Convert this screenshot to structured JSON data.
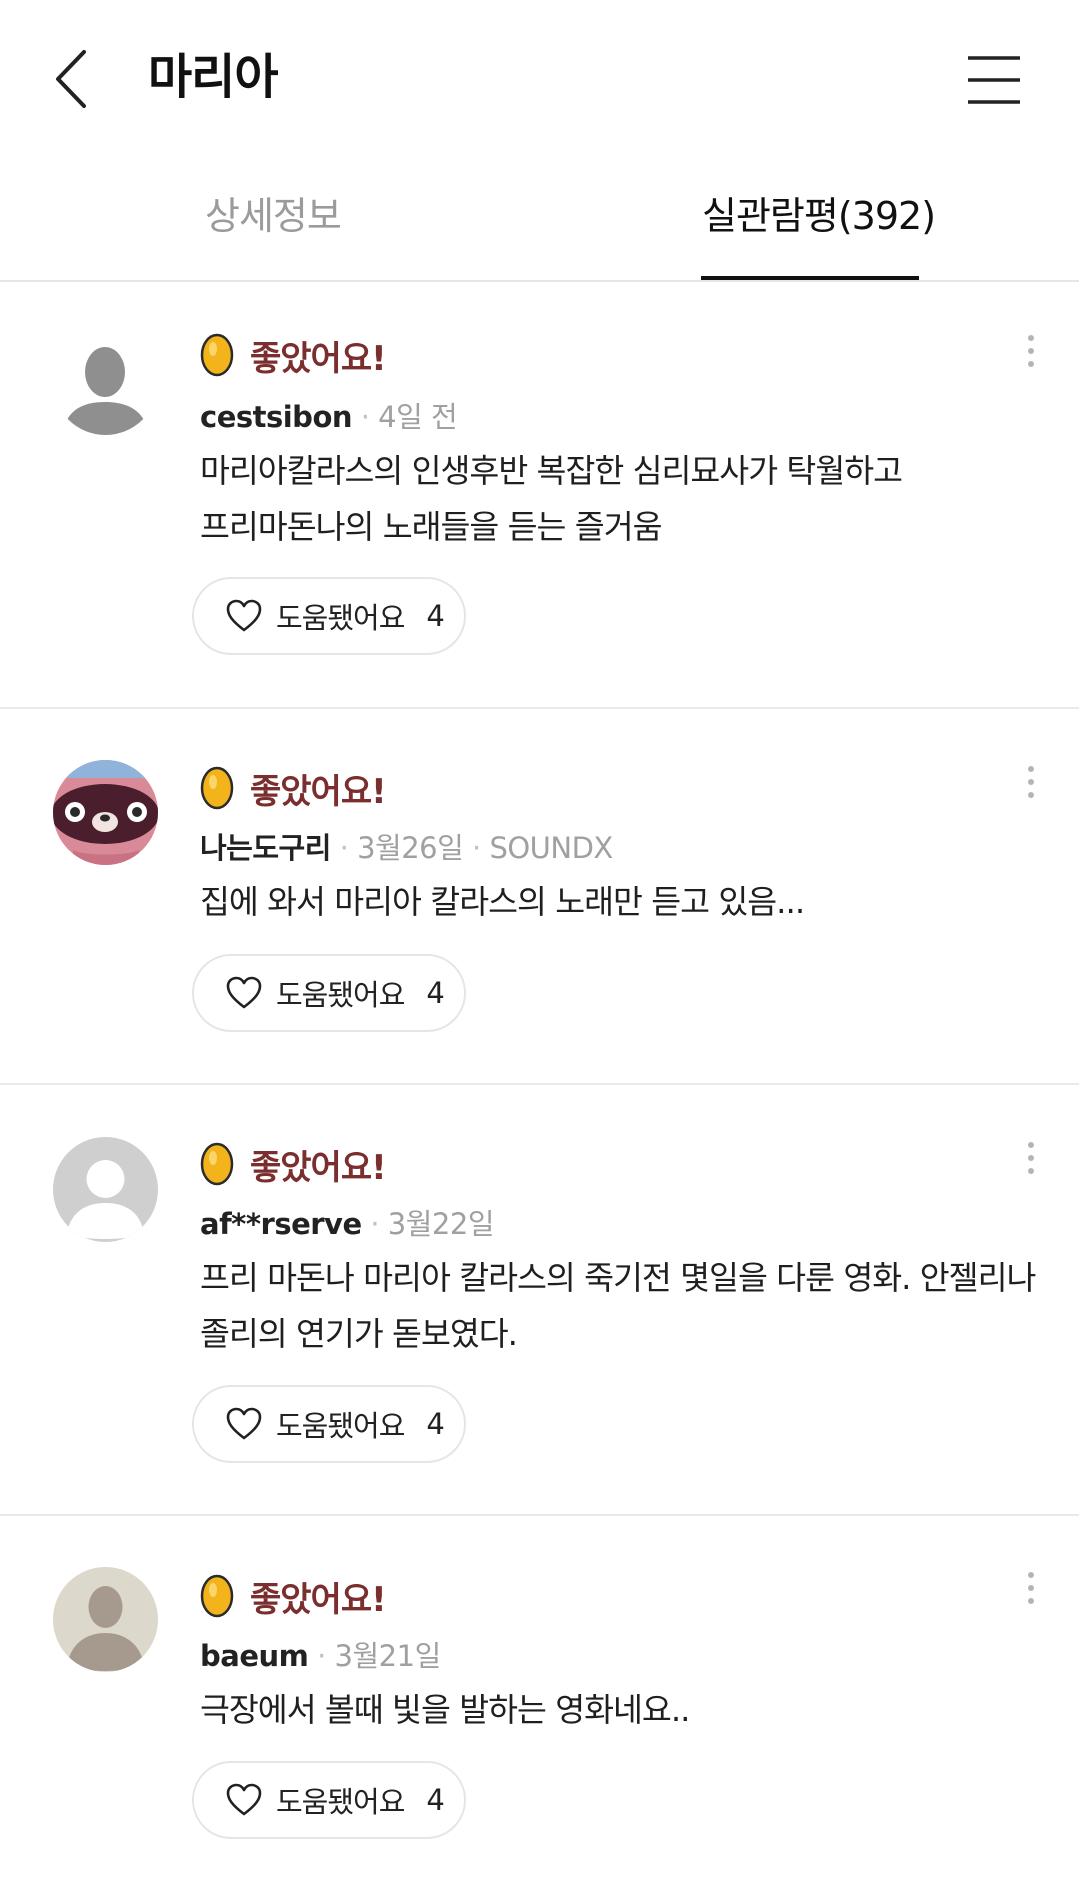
{
  "header": {
    "title": "마리아",
    "back_icon": "chevron-left-icon",
    "menu_icon": "hamburger-menu-icon"
  },
  "tabs": [
    {
      "label": "상세정보",
      "active": false
    },
    {
      "label": "실관람평(392)",
      "active": true
    }
  ],
  "colors": {
    "rating_text": "#7b2e2e",
    "egg_gold": "#f2b31b",
    "muted_text": "#a0a0a0",
    "active_tab": "#111111"
  },
  "reviews": [
    {
      "rating_label": "좋았어요!",
      "author": "cestsibon",
      "date": "4일 전",
      "source": "",
      "text": "마리아칼라스의 인생후반 복잡한 심리묘사가 탁월하고 프리마돈나의 노래들을 듣는 즐거움",
      "helpful_label": "도움됐어요",
      "helpful_count": "4",
      "avatar": "default-silhouette"
    },
    {
      "rating_label": "좋았어요!",
      "author": "나는도구리",
      "date": "3월26일",
      "source": "SOUNDX",
      "text": "집에 와서 마리아 칼라스의 노래만 듣고 있음...",
      "helpful_label": "도움됐어요",
      "helpful_count": "4",
      "avatar": "character-avatar"
    },
    {
      "rating_label": "좋았어요!",
      "author": "af**rserve",
      "date": "3월22일",
      "source": "",
      "text": "프리 마돈나 마리아 칼라스의 죽기전 몇일을 다룬 영화. 안젤리나 졸리의 연기가 돋보였다.",
      "helpful_label": "도움됐어요",
      "helpful_count": "4",
      "avatar": "default-gray-circle"
    },
    {
      "rating_label": "좋았어요!",
      "author": "baeum",
      "date": "3월21일",
      "source": "",
      "text": "극장에서 볼때 빛을 발하는 영화네요..",
      "helpful_label": "도움됐어요",
      "helpful_count": "4",
      "avatar": "default-beige-circle"
    }
  ]
}
